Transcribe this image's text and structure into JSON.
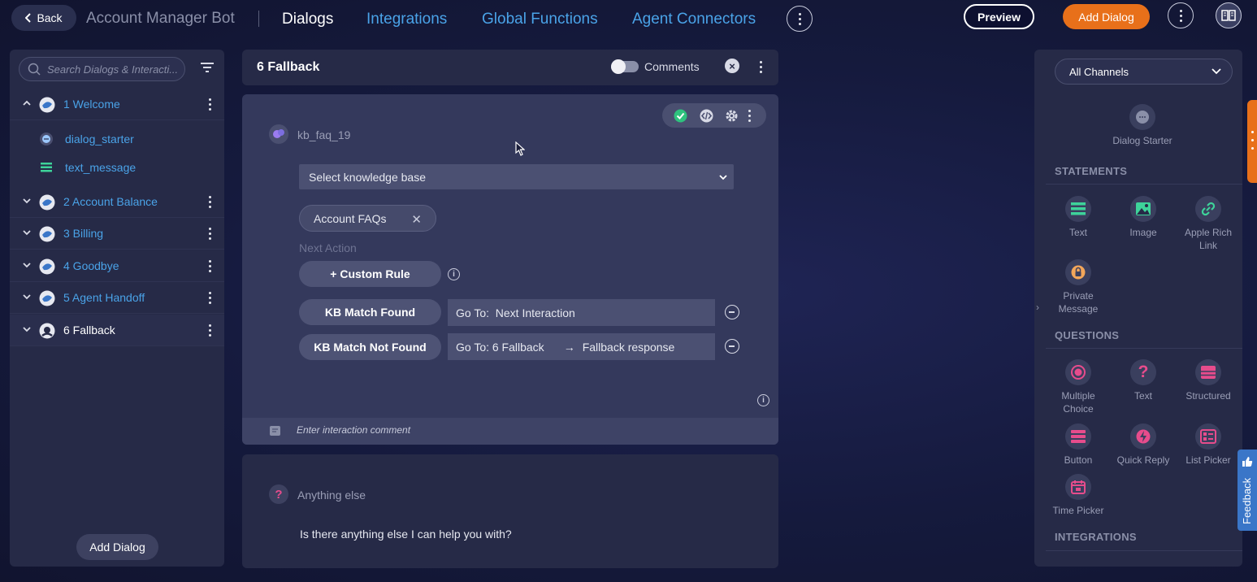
{
  "topbar": {
    "back_label": "Back",
    "bot_name": "Account Manager Bot",
    "tabs": [
      "Dialogs",
      "Integrations",
      "Global Functions",
      "Agent Connectors"
    ],
    "preview_label": "Preview",
    "add_dialog_label": "Add Dialog"
  },
  "sidebar": {
    "search_placeholder": "Search Dialogs & Interacti...",
    "dialogs": [
      {
        "label": "1 Welcome",
        "expanded": true
      },
      {
        "label": "2 Account Balance",
        "expanded": false
      },
      {
        "label": "3 Billing",
        "expanded": false
      },
      {
        "label": "4 Goodbye",
        "expanded": false
      },
      {
        "label": "5 Agent Handoff",
        "expanded": false
      },
      {
        "label": "6 Fallback",
        "expanded": false,
        "selected": true
      }
    ],
    "sub_items": [
      {
        "label": "dialog_starter",
        "icon": "chat-bubble-icon"
      },
      {
        "label": "text_message",
        "icon": "text-lines-icon"
      }
    ],
    "add_dialog_label": "Add Dialog"
  },
  "center": {
    "title": "6 Fallback",
    "comments_label": "Comments",
    "card": {
      "name": "kb_faq_19",
      "kb_select_label": "Select knowledge base",
      "chip_label": "Account FAQs",
      "next_action_label": "Next Action",
      "custom_rule_label": "+ Custom Rule",
      "rules": [
        {
          "label": "KB Match Found",
          "goto": "Go To:  Next Interaction"
        },
        {
          "label": "KB Match Not Found",
          "goto": "Go To: 6 Fallback",
          "arrow": "→",
          "target": "Fallback response"
        }
      ],
      "comment_placeholder": "Enter interaction comment"
    },
    "card2": {
      "name": "Anything else",
      "text": "Is there anything else I can help you with?"
    }
  },
  "palette": {
    "channel": "All Channels",
    "dialog_starter_label": "Dialog Starter",
    "statements_title": "STATEMENTS",
    "statements": [
      "Text",
      "Image",
      "Apple Rich Link",
      "Private Message"
    ],
    "questions_title": "QUESTIONS",
    "questions": [
      "Multiple Choice",
      "Text",
      "Structured",
      "Button",
      "Quick Reply",
      "List Picker",
      "Time Picker"
    ],
    "integrations_title": "INTEGRATIONS"
  },
  "feedback_label": "Feedback",
  "colors": {
    "accent_orange": "#e8701a",
    "link_blue": "#4aa3e8",
    "statement_green": "#3ed39a",
    "question_pink": "#e74c8c"
  }
}
